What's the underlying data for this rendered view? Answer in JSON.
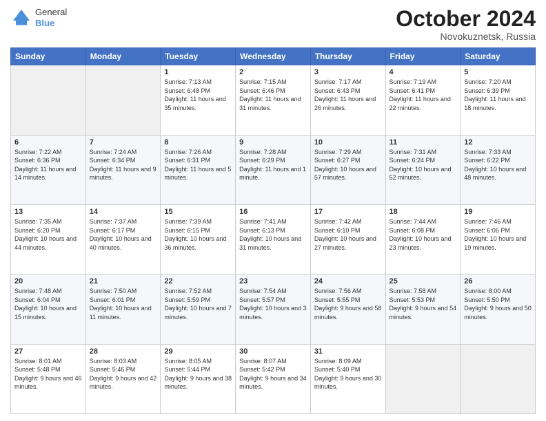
{
  "logo": {
    "general": "General",
    "blue": "Blue"
  },
  "header": {
    "title": "October 2024",
    "location": "Novokuznetsk, Russia"
  },
  "columns": [
    "Sunday",
    "Monday",
    "Tuesday",
    "Wednesday",
    "Thursday",
    "Friday",
    "Saturday"
  ],
  "weeks": [
    [
      {
        "day": "",
        "info": ""
      },
      {
        "day": "",
        "info": ""
      },
      {
        "day": "1",
        "info": "Sunrise: 7:13 AM\nSunset: 6:48 PM\nDaylight: 11 hours and 35 minutes."
      },
      {
        "day": "2",
        "info": "Sunrise: 7:15 AM\nSunset: 6:46 PM\nDaylight: 11 hours and 31 minutes."
      },
      {
        "day": "3",
        "info": "Sunrise: 7:17 AM\nSunset: 6:43 PM\nDaylight: 11 hours and 26 minutes."
      },
      {
        "day": "4",
        "info": "Sunrise: 7:19 AM\nSunset: 6:41 PM\nDaylight: 11 hours and 22 minutes."
      },
      {
        "day": "5",
        "info": "Sunrise: 7:20 AM\nSunset: 6:39 PM\nDaylight: 11 hours and 18 minutes."
      }
    ],
    [
      {
        "day": "6",
        "info": "Sunrise: 7:22 AM\nSunset: 6:36 PM\nDaylight: 11 hours and 14 minutes."
      },
      {
        "day": "7",
        "info": "Sunrise: 7:24 AM\nSunset: 6:34 PM\nDaylight: 11 hours and 9 minutes."
      },
      {
        "day": "8",
        "info": "Sunrise: 7:26 AM\nSunset: 6:31 PM\nDaylight: 11 hours and 5 minutes."
      },
      {
        "day": "9",
        "info": "Sunrise: 7:28 AM\nSunset: 6:29 PM\nDaylight: 11 hours and 1 minute."
      },
      {
        "day": "10",
        "info": "Sunrise: 7:29 AM\nSunset: 6:27 PM\nDaylight: 10 hours and 57 minutes."
      },
      {
        "day": "11",
        "info": "Sunrise: 7:31 AM\nSunset: 6:24 PM\nDaylight: 10 hours and 52 minutes."
      },
      {
        "day": "12",
        "info": "Sunrise: 7:33 AM\nSunset: 6:22 PM\nDaylight: 10 hours and 48 minutes."
      }
    ],
    [
      {
        "day": "13",
        "info": "Sunrise: 7:35 AM\nSunset: 6:20 PM\nDaylight: 10 hours and 44 minutes."
      },
      {
        "day": "14",
        "info": "Sunrise: 7:37 AM\nSunset: 6:17 PM\nDaylight: 10 hours and 40 minutes."
      },
      {
        "day": "15",
        "info": "Sunrise: 7:39 AM\nSunset: 6:15 PM\nDaylight: 10 hours and 36 minutes."
      },
      {
        "day": "16",
        "info": "Sunrise: 7:41 AM\nSunset: 6:13 PM\nDaylight: 10 hours and 31 minutes."
      },
      {
        "day": "17",
        "info": "Sunrise: 7:42 AM\nSunset: 6:10 PM\nDaylight: 10 hours and 27 minutes."
      },
      {
        "day": "18",
        "info": "Sunrise: 7:44 AM\nSunset: 6:08 PM\nDaylight: 10 hours and 23 minutes."
      },
      {
        "day": "19",
        "info": "Sunrise: 7:46 AM\nSunset: 6:06 PM\nDaylight: 10 hours and 19 minutes."
      }
    ],
    [
      {
        "day": "20",
        "info": "Sunrise: 7:48 AM\nSunset: 6:04 PM\nDaylight: 10 hours and 15 minutes."
      },
      {
        "day": "21",
        "info": "Sunrise: 7:50 AM\nSunset: 6:01 PM\nDaylight: 10 hours and 11 minutes."
      },
      {
        "day": "22",
        "info": "Sunrise: 7:52 AM\nSunset: 5:59 PM\nDaylight: 10 hours and 7 minutes."
      },
      {
        "day": "23",
        "info": "Sunrise: 7:54 AM\nSunset: 5:57 PM\nDaylight: 10 hours and 3 minutes."
      },
      {
        "day": "24",
        "info": "Sunrise: 7:56 AM\nSunset: 5:55 PM\nDaylight: 9 hours and 58 minutes."
      },
      {
        "day": "25",
        "info": "Sunrise: 7:58 AM\nSunset: 5:53 PM\nDaylight: 9 hours and 54 minutes."
      },
      {
        "day": "26",
        "info": "Sunrise: 8:00 AM\nSunset: 5:50 PM\nDaylight: 9 hours and 50 minutes."
      }
    ],
    [
      {
        "day": "27",
        "info": "Sunrise: 8:01 AM\nSunset: 5:48 PM\nDaylight: 9 hours and 46 minutes."
      },
      {
        "day": "28",
        "info": "Sunrise: 8:03 AM\nSunset: 5:46 PM\nDaylight: 9 hours and 42 minutes."
      },
      {
        "day": "29",
        "info": "Sunrise: 8:05 AM\nSunset: 5:44 PM\nDaylight: 9 hours and 38 minutes."
      },
      {
        "day": "30",
        "info": "Sunrise: 8:07 AM\nSunset: 5:42 PM\nDaylight: 9 hours and 34 minutes."
      },
      {
        "day": "31",
        "info": "Sunrise: 8:09 AM\nSunset: 5:40 PM\nDaylight: 9 hours and 30 minutes."
      },
      {
        "day": "",
        "info": ""
      },
      {
        "day": "",
        "info": ""
      }
    ]
  ]
}
